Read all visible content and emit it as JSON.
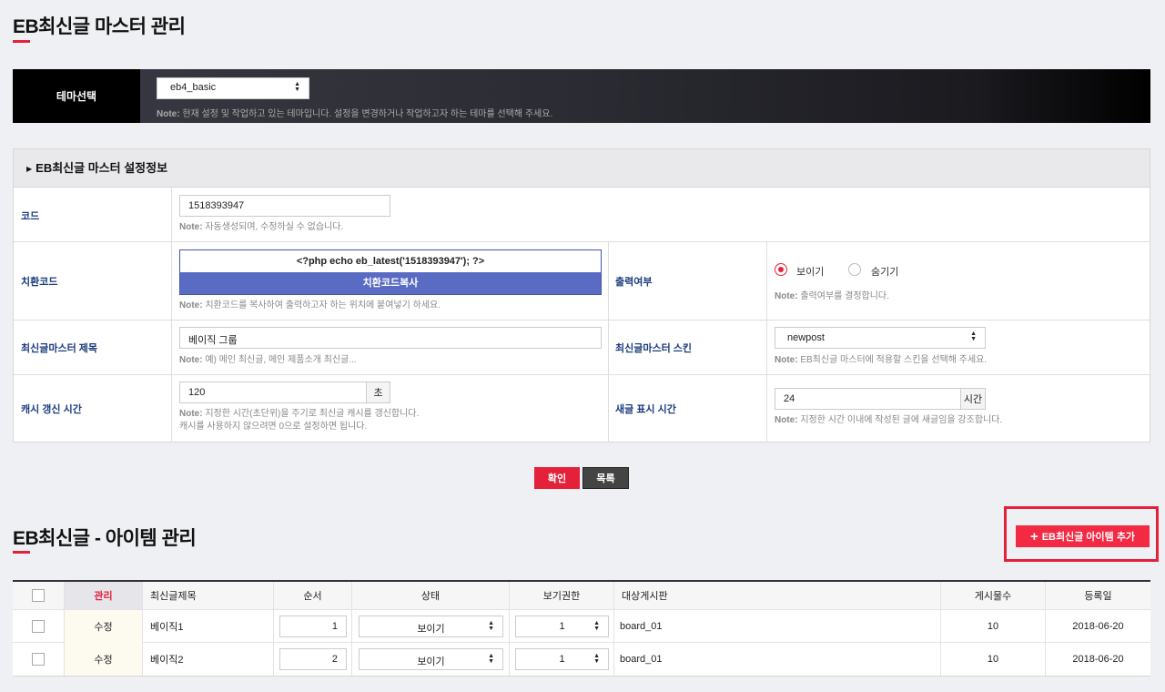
{
  "page": {
    "title": "EB최신글 마스터 관리",
    "accent_color": "#e5213a"
  },
  "theme": {
    "label": "테마선택",
    "value": "eb4_basic",
    "note_prefix": "Note:",
    "note": "현재 설정 및 작업하고 있는 테마입니다. 설정을 변경하거나 작업하고자 하는 테마를 선택해 주세요."
  },
  "settings": {
    "header": "EB최신글 마스터 설정정보",
    "code": {
      "label": "코드",
      "value": "1518393947",
      "note_prefix": "Note:",
      "note": "자동생성되며, 수정하실 수 없습니다."
    },
    "replace_code": {
      "label": "치환코드",
      "value": "<?php echo eb_latest('1518393947'); ?>",
      "copy_button": "치환코드복사",
      "note_prefix": "Note:",
      "note": "치환코드를 복사하여 출력하고자 하는 위치에 붙여넣기 하세요."
    },
    "output": {
      "label": "출력여부",
      "option_show": "보이기",
      "option_hide": "숨기기",
      "selected": "보이기",
      "note_prefix": "Note:",
      "note": "출력여부를 결정합니다."
    },
    "master_title": {
      "label": "최신글마스터 제목",
      "value": "베이직 그룹",
      "note_prefix": "Note:",
      "note": "예) 메인 최신글, 메인 제품소개 최신글..."
    },
    "master_skin": {
      "label": "최신글마스터 스킨",
      "value": "newpost",
      "note_prefix": "Note:",
      "note": "EB최신글 마스터에 적용할 스킨을 선택해 주세요."
    },
    "cache": {
      "label": "캐시 갱신 시간",
      "value": "120",
      "unit": "초",
      "note_prefix": "Note:",
      "note": "지정한 시간(초단위)을 주기로 최신글 캐시를 갱신합니다.",
      "note_line2": "캐시를 사용하지 않으려면 0으로 설정하면 됩니다."
    },
    "new_display": {
      "label": "새글 표시 시간",
      "value": "24",
      "unit": "시간",
      "note_prefix": "Note:",
      "note": "지정한 시간 이내에 작성된 글에 새글임을 강조합니다."
    }
  },
  "actions": {
    "confirm": "확인",
    "list": "목록"
  },
  "items": {
    "title": "EB최신글 - 아이템 관리",
    "add_button": "EB최신글 아이템 추가",
    "columns": [
      "관리",
      "최신글제목",
      "순서",
      "상태",
      "보기권한",
      "대상게시판",
      "게시물수",
      "등록일"
    ],
    "edit_label": "수정",
    "rows": [
      {
        "title": "베이직1",
        "order": "1",
        "status": "보이기",
        "permission": "1",
        "board": "board_01",
        "count": "10",
        "date": "2018-06-20"
      },
      {
        "title": "베이직2",
        "order": "2",
        "status": "보이기",
        "permission": "1",
        "board": "board_01",
        "count": "10",
        "date": "2018-06-20"
      }
    ]
  }
}
